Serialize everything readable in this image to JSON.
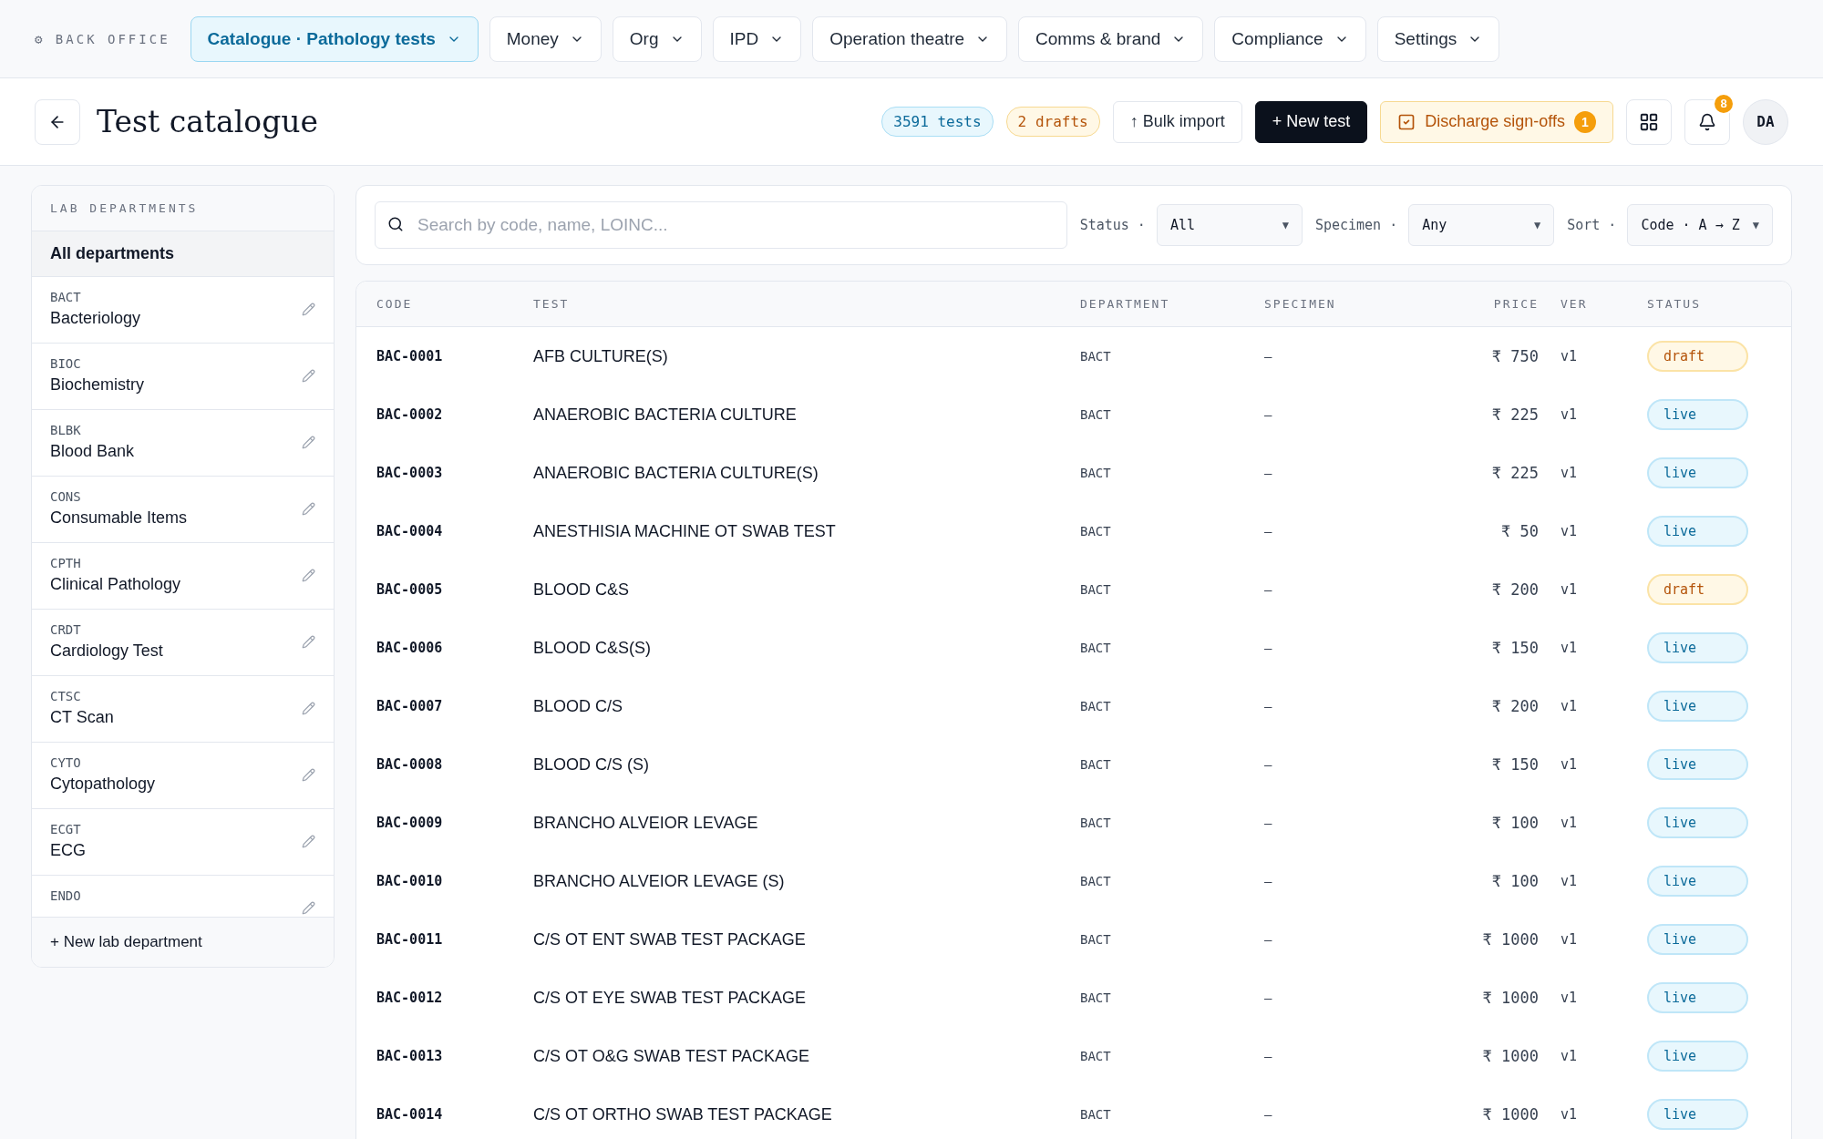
{
  "topbar": {
    "brand": "⚙ BACK OFFICE",
    "menus": [
      {
        "label": "Catalogue · Pathology tests",
        "selected": true
      },
      {
        "label": "Money",
        "selected": false
      },
      {
        "label": "Org",
        "selected": false
      },
      {
        "label": "IPD",
        "selected": false
      },
      {
        "label": "Operation theatre",
        "selected": false
      },
      {
        "label": "Comms & brand",
        "selected": false
      },
      {
        "label": "Compliance",
        "selected": false
      },
      {
        "label": "Settings",
        "selected": false
      }
    ]
  },
  "header": {
    "title": "Test catalogue",
    "tests_count": "3591 tests",
    "drafts_count": "2 drafts",
    "bulk_import": "↑ Bulk import",
    "new_test": "+ New test",
    "signoffs": {
      "label": "Discharge sign-offs",
      "count": "1"
    },
    "notifications": "8",
    "avatar": "DA"
  },
  "sidebar": {
    "heading": "LAB DEPARTMENTS",
    "all": {
      "label": "All departments",
      "selected": true
    },
    "items": [
      {
        "code": "BACT",
        "name": "Bacteriology",
        "selected": false
      },
      {
        "code": "BIOC",
        "name": "Biochemistry",
        "selected": false
      },
      {
        "code": "BLBK",
        "name": "Blood Bank",
        "selected": false
      },
      {
        "code": "CONS",
        "name": "Consumable Items",
        "selected": false
      },
      {
        "code": "CPTH",
        "name": "Clinical Pathology",
        "selected": false
      },
      {
        "code": "CRDT",
        "name": "Cardiology Test",
        "selected": false
      },
      {
        "code": "CTSC",
        "name": "CT Scan",
        "selected": false
      },
      {
        "code": "CYTO",
        "name": "Cytopathology",
        "selected": false
      },
      {
        "code": "ECGT",
        "name": "ECG",
        "selected": false
      },
      {
        "code": "ENDO",
        "selected": false
      }
    ],
    "footer": "+ New lab department"
  },
  "filters": {
    "search_placeholder": "Search by code, name, LOINC...",
    "status": {
      "label": "Status ·",
      "value": "All",
      "caret": "▼"
    },
    "specimen": {
      "label": "Specimen ·",
      "value": "Any",
      "caret": "▼"
    },
    "sort": {
      "label": "Sort ·",
      "value": "Code · A → Z",
      "caret": "▼"
    }
  },
  "table": {
    "columns": [
      "CODE",
      "TEST",
      "DEPARTMENT",
      "SPECIMEN",
      "PRICE",
      "VER",
      "STATUS"
    ],
    "rows": [
      {
        "code": "BAC-0001",
        "test": "AFB CULTURE(S)",
        "department": "BACT",
        "specimen": "—",
        "price": "₹ 750",
        "ver": "v1",
        "status": "draft",
        "kind": "draft"
      },
      {
        "code": "BAC-0002",
        "test": "ANAEROBIC BACTERIA CULTURE",
        "department": "BACT",
        "specimen": "—",
        "price": "₹ 225",
        "ver": "v1",
        "status": "live",
        "kind": "live"
      },
      {
        "code": "BAC-0003",
        "test": "ANAEROBIC BACTERIA CULTURE(S)",
        "department": "BACT",
        "specimen": "—",
        "price": "₹ 225",
        "ver": "v1",
        "status": "live",
        "kind": "live"
      },
      {
        "code": "BAC-0004",
        "test": "ANESTHISIA MACHINE OT SWAB TEST",
        "department": "BACT",
        "specimen": "—",
        "price": "₹ 50",
        "ver": "v1",
        "status": "live",
        "kind": "live"
      },
      {
        "code": "BAC-0005",
        "test": "BLOOD C&S",
        "department": "BACT",
        "specimen": "—",
        "price": "₹ 200",
        "ver": "v1",
        "status": "draft",
        "kind": "draft"
      },
      {
        "code": "BAC-0006",
        "test": "BLOOD C&S(S)",
        "department": "BACT",
        "specimen": "—",
        "price": "₹ 150",
        "ver": "v1",
        "status": "live",
        "kind": "live"
      },
      {
        "code": "BAC-0007",
        "test": "BLOOD C/S",
        "department": "BACT",
        "specimen": "—",
        "price": "₹ 200",
        "ver": "v1",
        "status": "live",
        "kind": "live"
      },
      {
        "code": "BAC-0008",
        "test": "BLOOD C/S (S)",
        "department": "BACT",
        "specimen": "—",
        "price": "₹ 150",
        "ver": "v1",
        "status": "live",
        "kind": "live"
      },
      {
        "code": "BAC-0009",
        "test": "BRANCHO ALVEIOR LEVAGE",
        "department": "BACT",
        "specimen": "—",
        "price": "₹ 100",
        "ver": "v1",
        "status": "live",
        "kind": "live"
      },
      {
        "code": "BAC-0010",
        "test": "BRANCHO ALVEIOR LEVAGE (S)",
        "department": "BACT",
        "specimen": "—",
        "price": "₹ 100",
        "ver": "v1",
        "status": "live",
        "kind": "live"
      },
      {
        "code": "BAC-0011",
        "test": "C/S OT ENT SWAB TEST PACKAGE",
        "department": "BACT",
        "specimen": "—",
        "price": "₹ 1000",
        "ver": "v1",
        "status": "live",
        "kind": "live"
      },
      {
        "code": "BAC-0012",
        "test": "C/S OT EYE SWAB TEST PACKAGE",
        "department": "BACT",
        "specimen": "—",
        "price": "₹ 1000",
        "ver": "v1",
        "status": "live",
        "kind": "live"
      },
      {
        "code": "BAC-0013",
        "test": "C/S OT O&G SWAB TEST PACKAGE",
        "department": "BACT",
        "specimen": "—",
        "price": "₹ 1000",
        "ver": "v1",
        "status": "live",
        "kind": "live"
      },
      {
        "code": "BAC-0014",
        "test": "C/S OT ORTHO SWAB TEST PACKAGE",
        "department": "BACT",
        "specimen": "—",
        "price": "₹ 1000",
        "ver": "v1",
        "status": "live",
        "kind": "live"
      }
    ]
  }
}
